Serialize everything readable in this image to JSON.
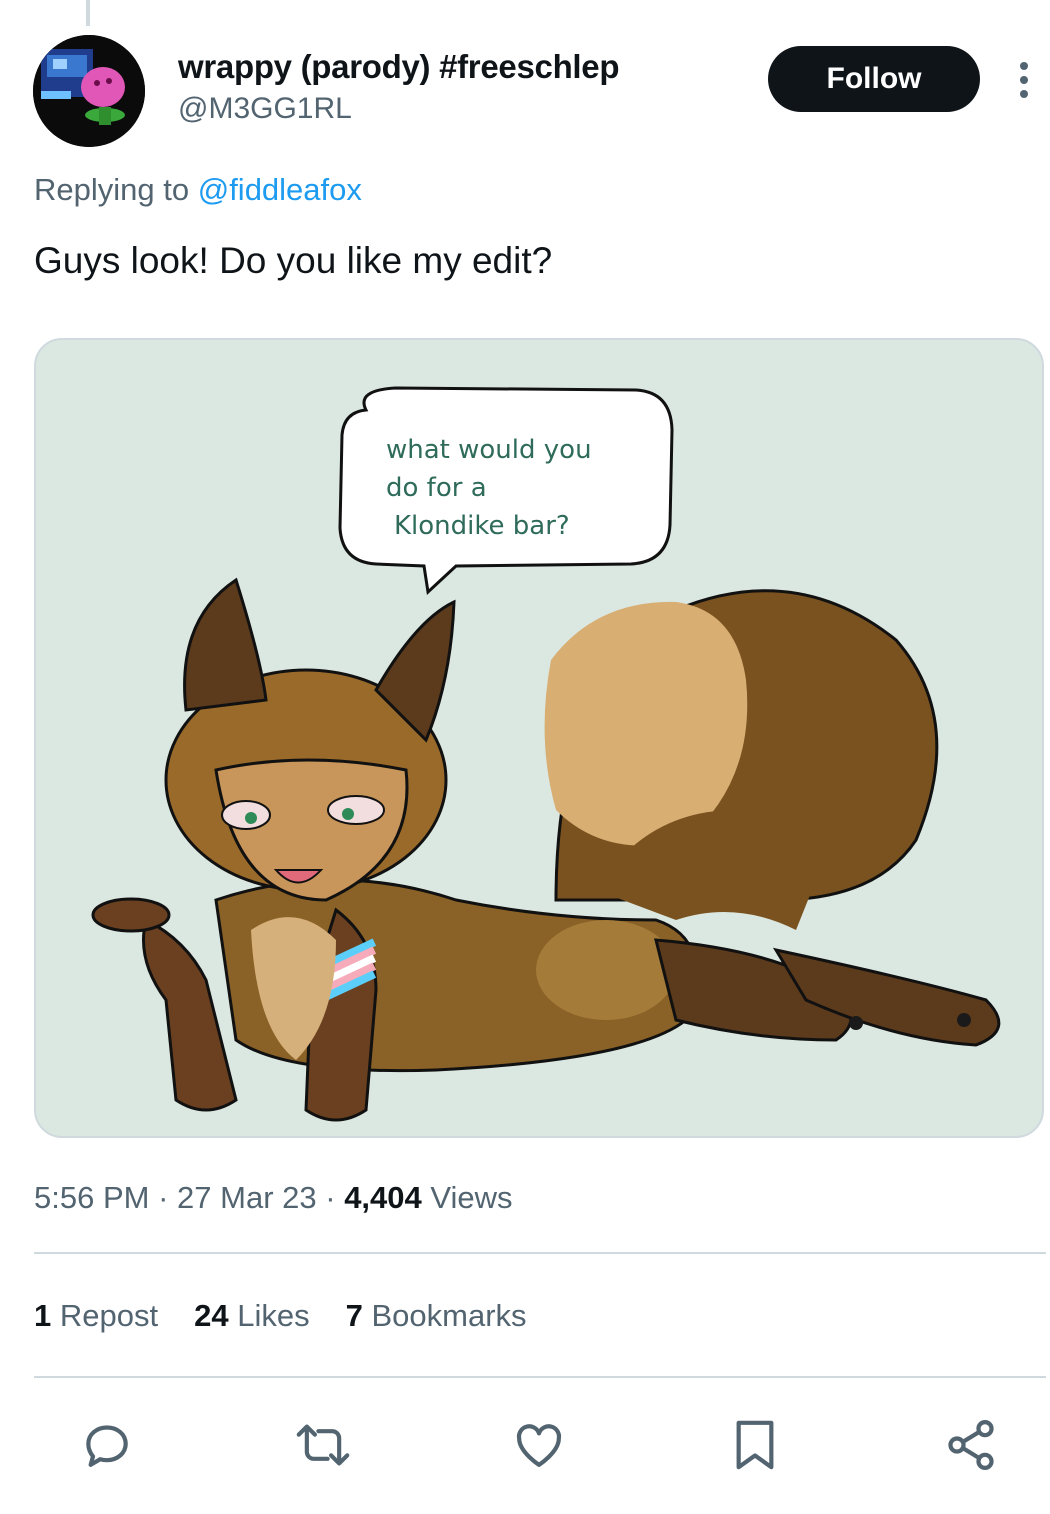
{
  "author": {
    "display_name": "wrappy (parody) #freeschlep",
    "handle": "@M3GG1RL"
  },
  "follow_label": "Follow",
  "reply": {
    "prefix": "Replying to ",
    "mention": "@fiddleafox"
  },
  "tweet_text": "Guys look! Do you like my edit?",
  "media": {
    "speech_lines": [
      "what would you",
      "do for a",
      "Klondike bar?"
    ]
  },
  "meta": {
    "time": "5:56 PM",
    "date": "27 Mar 23",
    "views_count": "4,404",
    "views_label": "Views",
    "sep": "·"
  },
  "stats": {
    "reposts_count": "1",
    "reposts_label": "Repost",
    "likes_count": "24",
    "likes_label": "Likes",
    "bookmarks_count": "7",
    "bookmarks_label": "Bookmarks"
  },
  "actions": [
    "reply-icon",
    "repost-icon",
    "like-icon",
    "bookmark-icon",
    "share-icon"
  ],
  "colors": {
    "accent": "#1d9bf0",
    "secondary_text": "#536471",
    "media_bg": "#dbe7e1"
  }
}
